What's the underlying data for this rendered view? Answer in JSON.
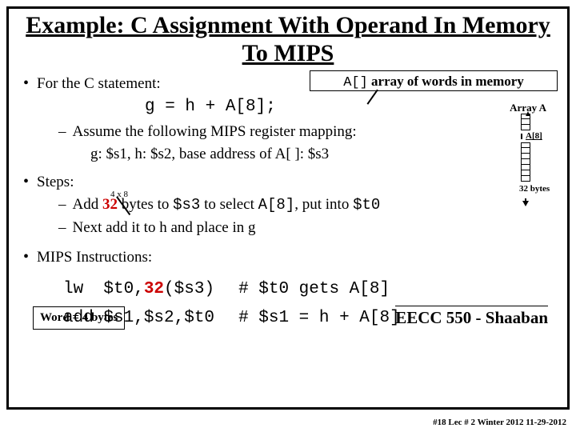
{
  "title": "Example:  C Assignment With Operand In Memory To MIPS",
  "b1": {
    "label": "For the C statement:"
  },
  "code": "g = h + A[8];",
  "callout1_a": "A[]",
  "callout1_b": " array of words in memory",
  "arraya": "Array A",
  "b2a": "Assume the following MIPS register mapping:",
  "b2b": "g: $s1,      h: $s2,      base address of A[ ]:  $s3",
  "a8": "A[8]",
  "b3": {
    "label": "Steps:"
  },
  "fourx8": "4 x 8",
  "s1a": "Add ",
  "s1b": "32",
  "s1c": " bytes to ",
  "s1d": "$s3",
  "s1e": " to select ",
  "s1f": "A[8]",
  "s1g": ", put into ",
  "s1h": "$t0",
  "s2": "Next add it to h and place in g",
  "b4": {
    "label": "MIPS Instructions:"
  },
  "mips": {
    "r1c1": "lw  $t0,",
    "r1c1b": "32",
    "r1c1c": "($s3)",
    "r1c2": "# $t0 gets A[8]",
    "r2c1": "add $s1,$s2,$t0",
    "r2c2": "# $s1 = h + A[8]"
  },
  "word4": "Word  = 4 bytes",
  "footer": "EECC 550 - Shaaban",
  "subfooter": "#18   Lec # 2   Winter 2012  11-29-2012",
  "bytes32": "32 bytes"
}
